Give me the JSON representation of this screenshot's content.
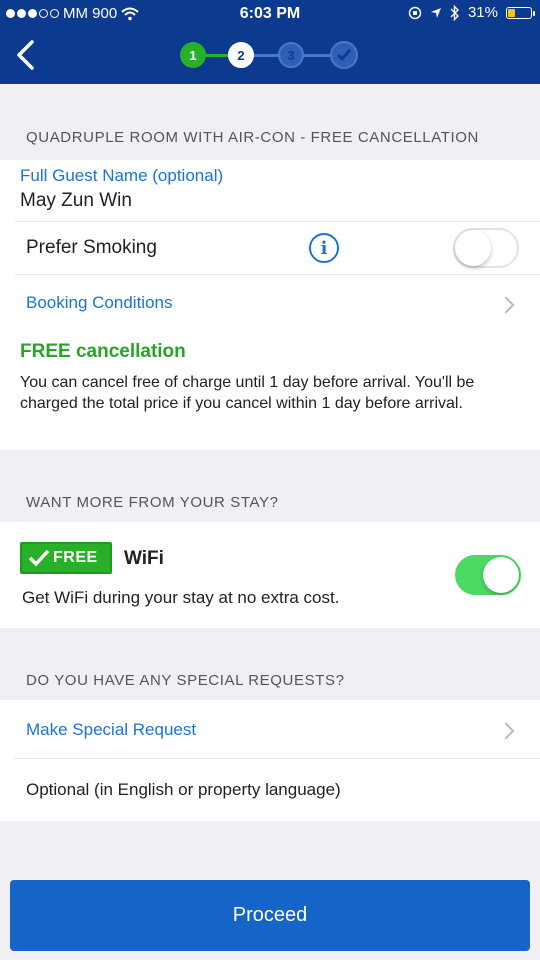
{
  "status_bar": {
    "carrier": "MM 900",
    "time": "6:03 PM",
    "battery": "31%",
    "battery_level": 0.31
  },
  "nav": {
    "steps": [
      "1",
      "2",
      "3"
    ],
    "current_step": 2
  },
  "room": {
    "section_title": "QUADRUPLE ROOM WITH AIR-CON - FREE CANCELLATION",
    "guest_label": "Full Guest Name (optional)",
    "guest_value": "May Zun Win",
    "smoking_label": "Prefer Smoking",
    "smoking_enabled": false,
    "booking_conditions": "Booking Conditions",
    "free_cancel_title": "FREE cancellation",
    "free_cancel_text": "You can cancel free of charge until 1 day before arrival. You'll be charged the total price if you cancel within 1 day before arrival."
  },
  "extras": {
    "section_title": "WANT MORE FROM YOUR STAY?",
    "badge": "FREE",
    "wifi_label": "WiFi",
    "wifi_desc": "Get WiFi during your stay at no extra cost.",
    "wifi_enabled": true
  },
  "requests": {
    "section_title": "DO YOU HAVE ANY SPECIAL REQUESTS?",
    "make_request": "Make Special Request",
    "optional_text": "Optional (in English or property language)"
  },
  "footer": {
    "proceed_label": "Proceed"
  },
  "colors": {
    "header": "#0b3a8f",
    "link": "#1a73d9",
    "free_green": "#28b128",
    "toggle_on": "#4cd964",
    "proceed": "#1565c8"
  }
}
